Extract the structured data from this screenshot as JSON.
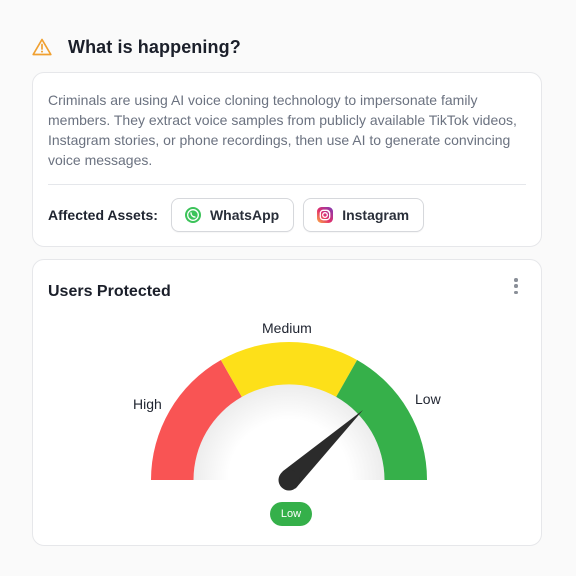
{
  "header": {
    "title": "What is happening?",
    "icon": "warning-icon",
    "icon_color": "#f0a030"
  },
  "info": {
    "description": "Criminals are using AI voice cloning technology to impersonate family members. They extract voice samples from publicly available TikTok videos, Instagram stories, or phone recordings, then use AI to generate convincing voice messages.",
    "assets_label": "Affected Assets:",
    "assets": [
      {
        "label": "WhatsApp",
        "icon": "whatsapp-icon"
      },
      {
        "label": "Instagram",
        "icon": "instagram-icon"
      }
    ]
  },
  "gauge": {
    "title": "Users Protected",
    "menu_icon": "more-vertical-icon",
    "labels": {
      "high": "High",
      "medium": "Medium",
      "low": "Low"
    },
    "colors": {
      "high": "#f95454",
      "medium": "#fde019",
      "low": "#36b04a"
    },
    "current_level": "Low",
    "badge": "Low"
  }
}
